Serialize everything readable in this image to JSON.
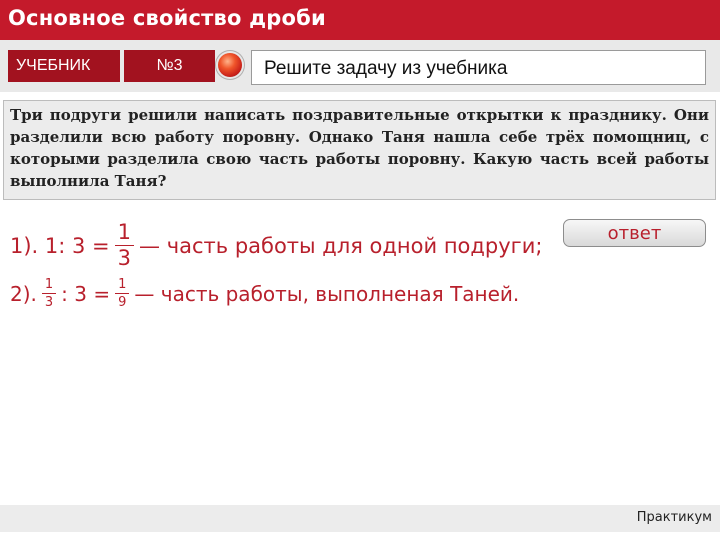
{
  "header": {
    "title": "Основное свойство дроби"
  },
  "tabs": [
    {
      "label": "УЧЕБНИК"
    },
    {
      "label": "№3"
    }
  ],
  "task_label": "Решите задачу из учебника",
  "problem_text": "Три подруги решили написать поздравительные открытки к празднику. Они разделили всю работу поровну. Однако Таня нашла себе трёх помощниц, с которыми разделила свою часть работы поровну. Какую часть всей работы выполнила Таня?",
  "answer_button": {
    "label": "ответ"
  },
  "solution": {
    "line1": {
      "prefix": "1). 1: 3 =",
      "frac_num": "1",
      "frac_den": "3",
      "suffix": "— часть работы для одной подруги;"
    },
    "line2": {
      "prefix": "2).",
      "frac1_num": "1",
      "frac1_den": "3",
      "middle": ": 3 =",
      "frac2_num": "1",
      "frac2_den": "9",
      "suffix": "— часть работы, выполненая Таней."
    }
  },
  "footer": {
    "label": "Практикум"
  },
  "colors": {
    "title_bar": "#c41a2b",
    "tab_button": "#a2121f",
    "solution_text": "#b8202c",
    "panel_bg": "#ececec"
  },
  "icons": {
    "orb": "red-orb-icon"
  }
}
